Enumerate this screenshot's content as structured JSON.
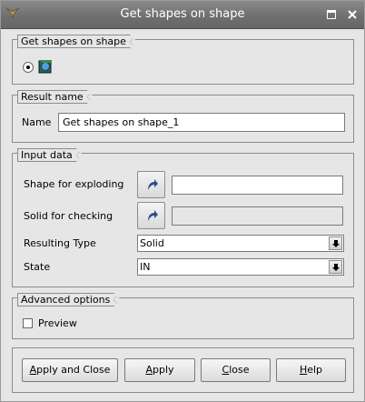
{
  "window": {
    "title": "Get shapes on shape"
  },
  "groups": {
    "shapes": {
      "title": "Get shapes on shape"
    },
    "result": {
      "title": "Result name",
      "name_label": "Name",
      "name_value": "Get shapes on shape_1"
    },
    "input": {
      "title": "Input data",
      "shape_label": "Shape for exploding",
      "solid_label": "Solid for checking",
      "type_label": "Resulting Type",
      "type_value": "Solid",
      "state_label": "State",
      "state_value": "IN"
    },
    "advanced": {
      "title": "Advanced options",
      "preview_label": "Preview",
      "preview_checked": false
    }
  },
  "buttons": {
    "apply_close": {
      "pre": "",
      "key": "A",
      "post": "pply and Close"
    },
    "apply": {
      "pre": "",
      "key": "A",
      "post": "pply"
    },
    "close": {
      "pre": "",
      "key": "C",
      "post": "lose"
    },
    "help": {
      "pre": "",
      "key": "H",
      "post": "elp"
    }
  },
  "icons": {
    "app": "app-menu-icon",
    "maximize": "maximize-icon",
    "close": "close-icon",
    "shape": "shape-constructor-icon",
    "select": "select-arrow-icon",
    "dropdown": "down-arrow-icon"
  }
}
